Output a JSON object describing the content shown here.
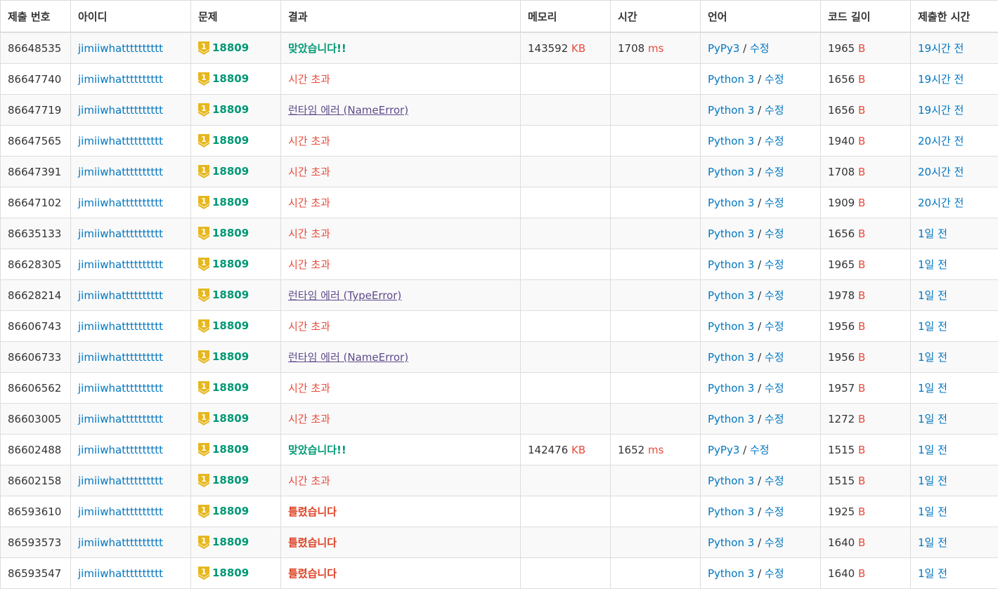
{
  "headers": [
    "제출 번호",
    "아이디",
    "문제",
    "결과",
    "메모리",
    "시간",
    "언어",
    "코드 길이",
    "제출한 시간"
  ],
  "rows": [
    {
      "id": "86648535",
      "user": "jimiiwhatttttttttt",
      "problem": "18809",
      "result": "맞았습니다!!",
      "result_type": "ac",
      "memory": "143592",
      "memory_unit": "KB",
      "time": "1708",
      "time_unit": "ms",
      "lang": "PyPy3",
      "edit": "수정",
      "code_len": "1965",
      "code_unit": "B",
      "submitted": "19시간 전"
    },
    {
      "id": "86647740",
      "user": "jimiiwhatttttttttt",
      "problem": "18809",
      "result": "시간 초과",
      "result_type": "tle",
      "memory": "",
      "memory_unit": "",
      "time": "",
      "time_unit": "",
      "lang": "Python 3",
      "edit": "수정",
      "code_len": "1656",
      "code_unit": "B",
      "submitted": "19시간 전"
    },
    {
      "id": "86647719",
      "user": "jimiiwhatttttttttt",
      "problem": "18809",
      "result": "런타임 에러 (NameError)",
      "result_type": "rte",
      "memory": "",
      "memory_unit": "",
      "time": "",
      "time_unit": "",
      "lang": "Python 3",
      "edit": "수정",
      "code_len": "1656",
      "code_unit": "B",
      "submitted": "19시간 전"
    },
    {
      "id": "86647565",
      "user": "jimiiwhatttttttttt",
      "problem": "18809",
      "result": "시간 초과",
      "result_type": "tle",
      "memory": "",
      "memory_unit": "",
      "time": "",
      "time_unit": "",
      "lang": "Python 3",
      "edit": "수정",
      "code_len": "1940",
      "code_unit": "B",
      "submitted": "20시간 전"
    },
    {
      "id": "86647391",
      "user": "jimiiwhatttttttttt",
      "problem": "18809",
      "result": "시간 초과",
      "result_type": "tle",
      "memory": "",
      "memory_unit": "",
      "time": "",
      "time_unit": "",
      "lang": "Python 3",
      "edit": "수정",
      "code_len": "1708",
      "code_unit": "B",
      "submitted": "20시간 전"
    },
    {
      "id": "86647102",
      "user": "jimiiwhatttttttttt",
      "problem": "18809",
      "result": "시간 초과",
      "result_type": "tle",
      "memory": "",
      "memory_unit": "",
      "time": "",
      "time_unit": "",
      "lang": "Python 3",
      "edit": "수정",
      "code_len": "1909",
      "code_unit": "B",
      "submitted": "20시간 전"
    },
    {
      "id": "86635133",
      "user": "jimiiwhatttttttttt",
      "problem": "18809",
      "result": "시간 초과",
      "result_type": "tle",
      "memory": "",
      "memory_unit": "",
      "time": "",
      "time_unit": "",
      "lang": "Python 3",
      "edit": "수정",
      "code_len": "1656",
      "code_unit": "B",
      "submitted": "1일 전"
    },
    {
      "id": "86628305",
      "user": "jimiiwhatttttttttt",
      "problem": "18809",
      "result": "시간 초과",
      "result_type": "tle",
      "memory": "",
      "memory_unit": "",
      "time": "",
      "time_unit": "",
      "lang": "Python 3",
      "edit": "수정",
      "code_len": "1965",
      "code_unit": "B",
      "submitted": "1일 전"
    },
    {
      "id": "86628214",
      "user": "jimiiwhatttttttttt",
      "problem": "18809",
      "result": "런타임 에러 (TypeError)",
      "result_type": "rte",
      "memory": "",
      "memory_unit": "",
      "time": "",
      "time_unit": "",
      "lang": "Python 3",
      "edit": "수정",
      "code_len": "1978",
      "code_unit": "B",
      "submitted": "1일 전"
    },
    {
      "id": "86606743",
      "user": "jimiiwhatttttttttt",
      "problem": "18809",
      "result": "시간 초과",
      "result_type": "tle",
      "memory": "",
      "memory_unit": "",
      "time": "",
      "time_unit": "",
      "lang": "Python 3",
      "edit": "수정",
      "code_len": "1956",
      "code_unit": "B",
      "submitted": "1일 전"
    },
    {
      "id": "86606733",
      "user": "jimiiwhatttttttttt",
      "problem": "18809",
      "result": "런타임 에러 (NameError)",
      "result_type": "rte",
      "memory": "",
      "memory_unit": "",
      "time": "",
      "time_unit": "",
      "lang": "Python 3",
      "edit": "수정",
      "code_len": "1956",
      "code_unit": "B",
      "submitted": "1일 전"
    },
    {
      "id": "86606562",
      "user": "jimiiwhatttttttttt",
      "problem": "18809",
      "result": "시간 초과",
      "result_type": "tle",
      "memory": "",
      "memory_unit": "",
      "time": "",
      "time_unit": "",
      "lang": "Python 3",
      "edit": "수정",
      "code_len": "1957",
      "code_unit": "B",
      "submitted": "1일 전"
    },
    {
      "id": "86603005",
      "user": "jimiiwhatttttttttt",
      "problem": "18809",
      "result": "시간 초과",
      "result_type": "tle",
      "memory": "",
      "memory_unit": "",
      "time": "",
      "time_unit": "",
      "lang": "Python 3",
      "edit": "수정",
      "code_len": "1272",
      "code_unit": "B",
      "submitted": "1일 전"
    },
    {
      "id": "86602488",
      "user": "jimiiwhatttttttttt",
      "problem": "18809",
      "result": "맞았습니다!!",
      "result_type": "ac",
      "memory": "142476",
      "memory_unit": "KB",
      "time": "1652",
      "time_unit": "ms",
      "lang": "PyPy3",
      "edit": "수정",
      "code_len": "1515",
      "code_unit": "B",
      "submitted": "1일 전"
    },
    {
      "id": "86602158",
      "user": "jimiiwhatttttttttt",
      "problem": "18809",
      "result": "시간 초과",
      "result_type": "tle",
      "memory": "",
      "memory_unit": "",
      "time": "",
      "time_unit": "",
      "lang": "Python 3",
      "edit": "수정",
      "code_len": "1515",
      "code_unit": "B",
      "submitted": "1일 전"
    },
    {
      "id": "86593610",
      "user": "jimiiwhatttttttttt",
      "problem": "18809",
      "result": "틀렸습니다",
      "result_type": "wa",
      "memory": "",
      "memory_unit": "",
      "time": "",
      "time_unit": "",
      "lang": "Python 3",
      "edit": "수정",
      "code_len": "1925",
      "code_unit": "B",
      "submitted": "1일 전"
    },
    {
      "id": "86593573",
      "user": "jimiiwhatttttttttt",
      "problem": "18809",
      "result": "틀렸습니다",
      "result_type": "wa",
      "memory": "",
      "memory_unit": "",
      "time": "",
      "time_unit": "",
      "lang": "Python 3",
      "edit": "수정",
      "code_len": "1640",
      "code_unit": "B",
      "submitted": "1일 전"
    },
    {
      "id": "86593547",
      "user": "jimiiwhatttttttttt",
      "problem": "18809",
      "result": "틀렸습니다",
      "result_type": "wa",
      "memory": "",
      "memory_unit": "",
      "time": "",
      "time_unit": "",
      "lang": "Python 3",
      "edit": "수정",
      "code_len": "1640",
      "code_unit": "B",
      "submitted": "1일 전"
    }
  ],
  "colors": {
    "accepted": "#009874",
    "tle": "#e74c3c",
    "wrong": "#dd4124",
    "runtime": "#5f4b8b",
    "link": "#0076c0",
    "tier_badge": "#e6b71e"
  },
  "badge_icon": "gold-tier-1-icon",
  "badge_digit": "1"
}
